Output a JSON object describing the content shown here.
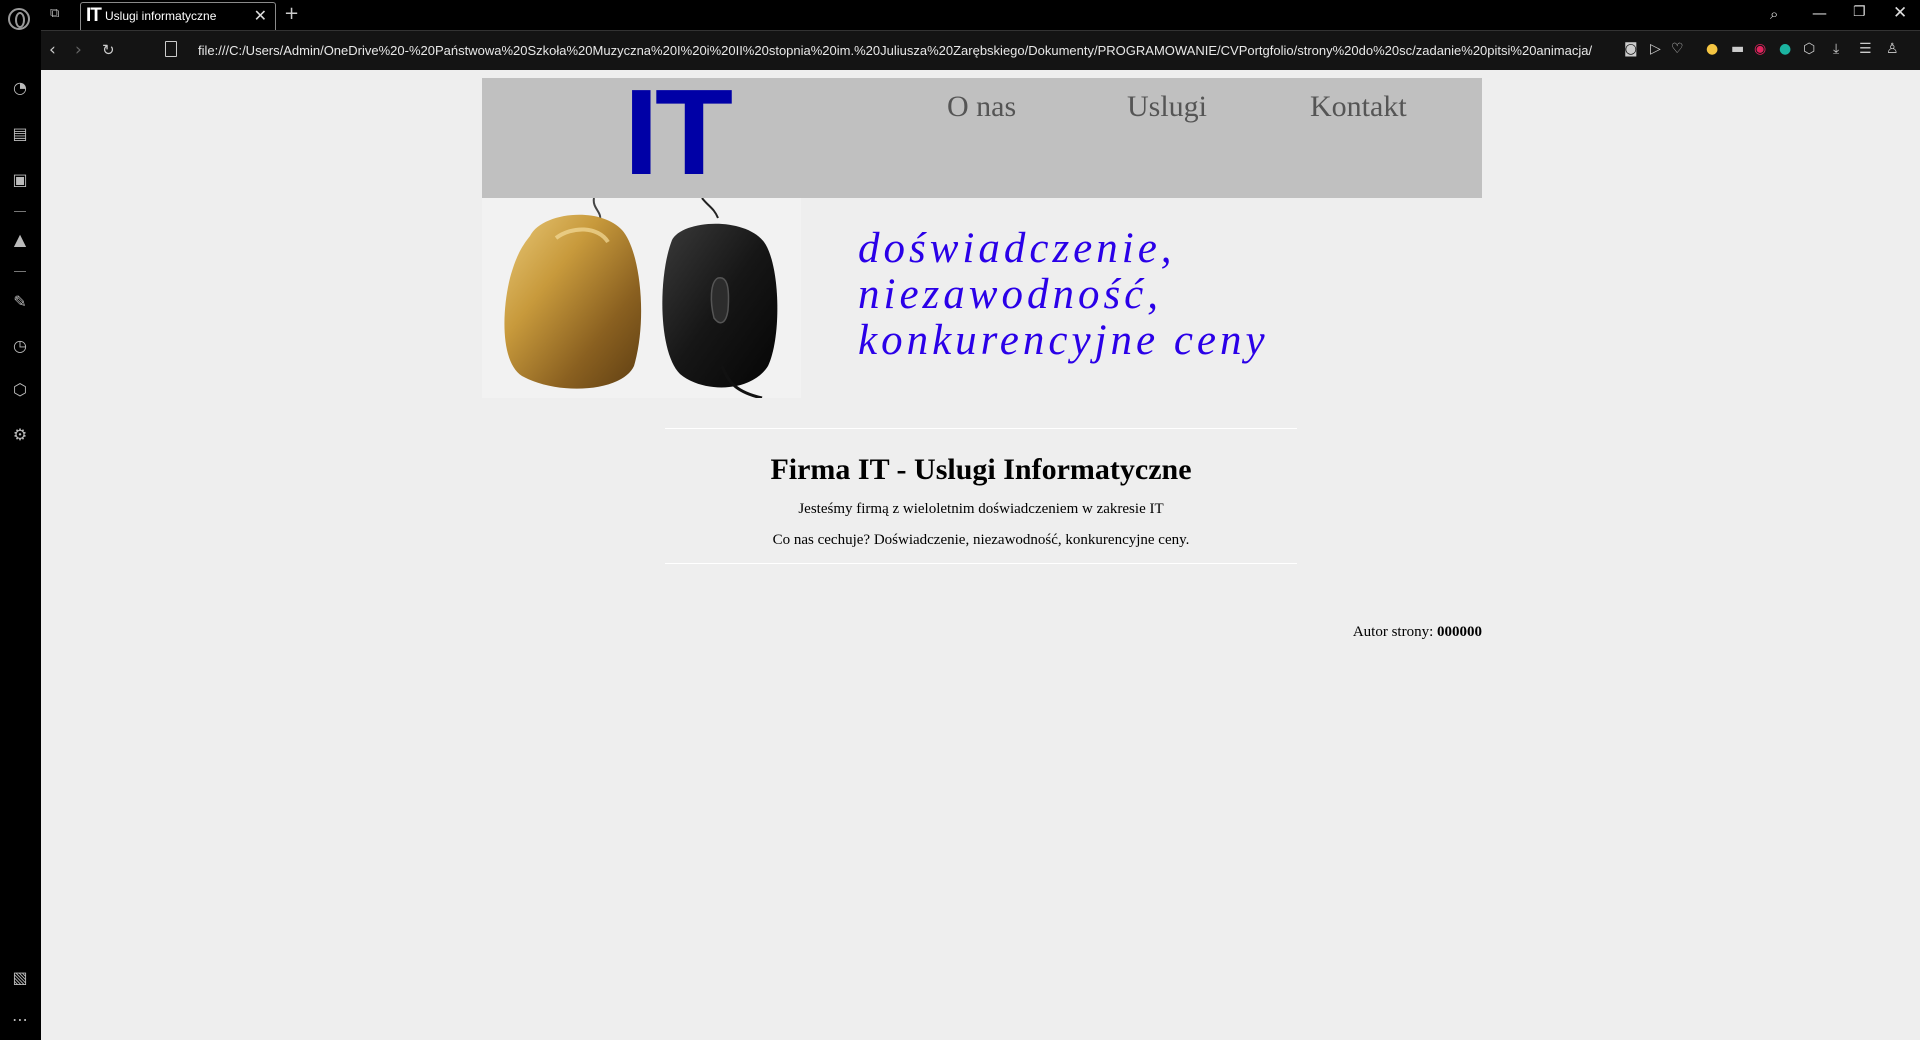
{
  "browser": {
    "tab": {
      "favicon": "IT",
      "title": "Uslugi informatyczne",
      "close": "✕"
    },
    "new_tab": "+",
    "url": "file:///C:/Users/Admin/OneDrive%20-%20Państwowa%20Szkoła%20Muzyczna%20I%20i%20II%20stopnia%20im.%20Juliusza%20Zarębskiego/Dokumenty/PROGRAMOWANIE/CVPortgfolio/strony%20do%20sc/zadanie%20pitsi%20animacja/",
    "icons": [
      "back-icon",
      "forward-icon",
      "reload-icon",
      "file-icon",
      "camera-icon",
      "send-icon",
      "heart-icon",
      "download-icon",
      "menu-icon",
      "profile-icon"
    ]
  },
  "page": {
    "logo": "IT",
    "nav": [
      "O nas",
      "Uslugi",
      "Kontakt"
    ],
    "slogan": [
      "doświadczenie,",
      "niezawodność,",
      "konkurencyjne ceny"
    ],
    "heading": "Firma IT - Uslugi Informatyczne",
    "paragraphs": [
      "Jesteśmy firmą z wieloletnim doświadczeniem w zakresie IT",
      "Co nas cechuje? Doświadczenie, niezawodność, konkurencyjne ceny."
    ],
    "author_label": "Autor strony:",
    "author_value": "000000"
  },
  "colors": {
    "logo": "#0000a6",
    "slogan": "#2a00e8",
    "header_bg": "#c0c0c0",
    "page_bg": "#eeeeee"
  }
}
